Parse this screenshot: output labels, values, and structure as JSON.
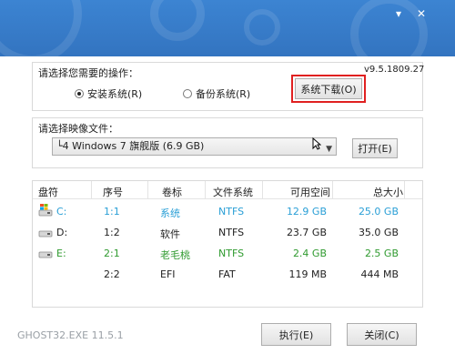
{
  "window": {
    "minimize_glyph": "▾",
    "close_glyph": "✕"
  },
  "version": "v9.5.1809.27",
  "operation": {
    "label": "请选择您需要的操作：",
    "install_label": "安装系统(R)",
    "backup_label": "备份系统(R)",
    "download_button": "系统下载(O)",
    "selected": "install"
  },
  "image": {
    "label": "请选择映像文件：",
    "selected_value": "└4 Windows 7 旗舰版 (6.9 GB)",
    "open_button": "打开(E)"
  },
  "table": {
    "headers": [
      "盘符",
      "序号",
      "卷标",
      "文件系统",
      "可用空间",
      "总大小"
    ],
    "rows": [
      {
        "drive": "C:",
        "index": "1:1",
        "label": "系统",
        "fs": "NTFS",
        "free": "12.9 GB",
        "total": "25.0 GB",
        "color": "#2a9fd6",
        "icon": "windows-drive-icon"
      },
      {
        "drive": "D:",
        "index": "1:2",
        "label": "软件",
        "fs": "NTFS",
        "free": "23.7 GB",
        "total": "35.0 GB",
        "color": "#222222",
        "icon": "drive-icon"
      },
      {
        "drive": "E:",
        "index": "2:1",
        "label": "老毛桃",
        "fs": "NTFS",
        "free": "2.4 GB",
        "total": "2.5 GB",
        "color": "#2f9a2f",
        "icon": "drive-icon"
      },
      {
        "drive": "",
        "index": "2:2",
        "label": "EFI",
        "fs": "FAT",
        "free": "119 MB",
        "total": "444 MB",
        "color": "#222222",
        "icon": ""
      }
    ]
  },
  "footer": {
    "app_version": "GHOST32.EXE 11.5.1",
    "run_button": "执行(E)",
    "close_button": "关闭(C)"
  },
  "colors": {
    "title_bar": "#3579c8",
    "highlight": "#e02020",
    "system_row": "#2a9fd6",
    "usb_row": "#2f9a2f"
  }
}
